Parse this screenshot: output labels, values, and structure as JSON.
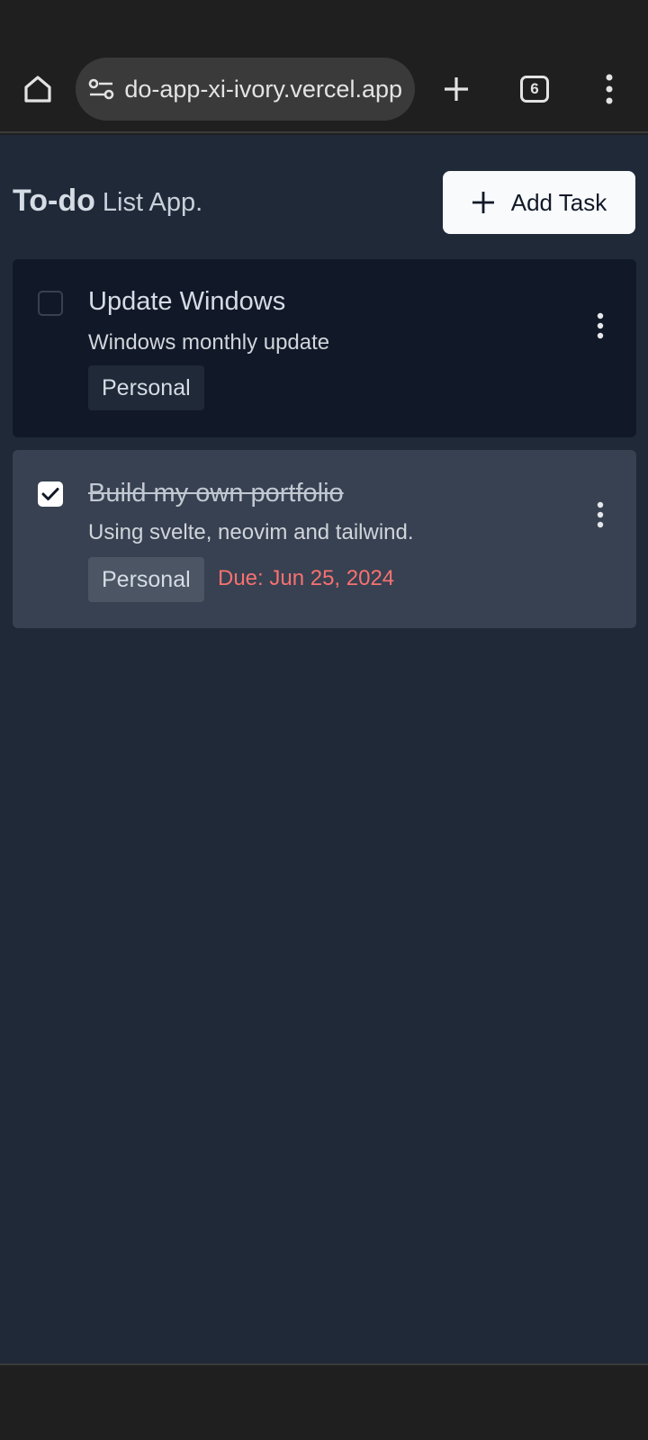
{
  "browser": {
    "url": "todo-app-xi-ivory.vercel.app",
    "tab_count": "6",
    "icons": [
      "home-icon",
      "site-settings-icon",
      "plus-icon",
      "more-vert-icon"
    ]
  },
  "app": {
    "title_brand": "To-do",
    "title_rest": " List App.",
    "add_task_label": "Add Task"
  },
  "tasks": [
    {
      "title": "Update Windows",
      "description": "Windows monthly update",
      "tag": "Personal",
      "due": "",
      "completed": false
    },
    {
      "title": "Build my own portfolio",
      "description": "Using svelte, neovim and tailwind.",
      "tag": "Personal",
      "due": "Due: Jun 25, 2024",
      "completed": true
    }
  ],
  "colors": {
    "app_background": "#1f2937",
    "card_active": "#111827",
    "card_completed": "#374151",
    "due_text": "#f87171",
    "browser_chrome": "#1f1f1f"
  }
}
